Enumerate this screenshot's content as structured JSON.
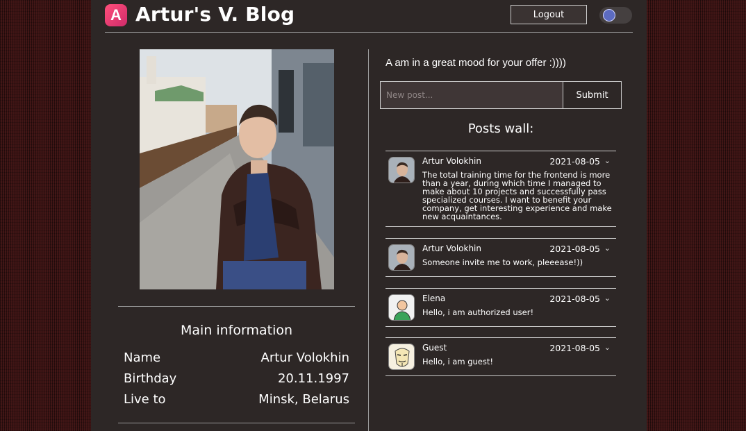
{
  "header": {
    "logo_letter": "A",
    "title": "Artur's V. Blog",
    "logout_label": "Logout"
  },
  "main_info": {
    "title": "Main information",
    "rows": [
      {
        "label": "Name",
        "value": "Artur Volokhin"
      },
      {
        "label": "Birthday",
        "value": "20.11.1997"
      },
      {
        "label": "Live to",
        "value": "Minsk, Belarus"
      }
    ]
  },
  "status_text": "A am in a great mood for your offer :))))",
  "new_post": {
    "placeholder": "New post...",
    "submit_label": "Submit"
  },
  "wall": {
    "title": "Posts wall:",
    "posts": [
      {
        "author": "Artur Volokhin",
        "date": "2021-08-05",
        "text": "The total training time for the frontend is more than a year, during which time I managed to make about 10 projects and successfully pass specialized courses. I want to benefit your company, get interesting experience and make new acquaintances.",
        "avatar": "photo-avatar"
      },
      {
        "author": "Artur Volokhin",
        "date": "2021-08-05",
        "text": "Someone invite me to work, pleeease!))",
        "avatar": "photo-avatar"
      },
      {
        "author": "Elena",
        "date": "2021-08-05",
        "text": "Hello, i am authorized user!",
        "avatar": "user-icon"
      },
      {
        "author": "Guest",
        "date": "2021-08-05",
        "text": "Hello, i am guest!",
        "avatar": "mask-icon"
      }
    ]
  },
  "colors": {
    "panel": "#2d2726",
    "accent": "#e23a6f",
    "toggle_knob": "#5c6bc0"
  }
}
